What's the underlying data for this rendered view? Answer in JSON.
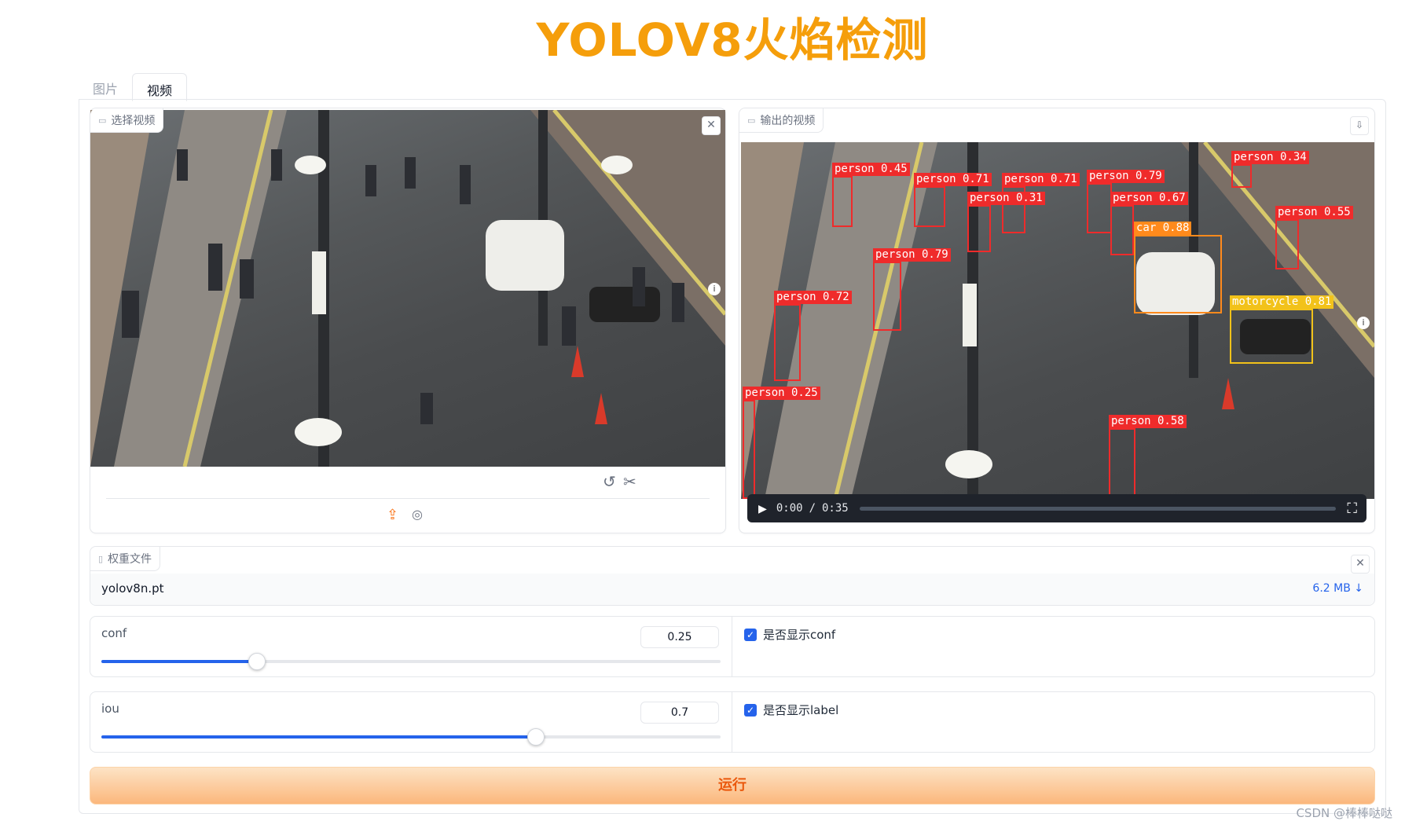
{
  "title": "YOLOV8火焰检测",
  "tabs": [
    {
      "label": "图片",
      "active": false
    },
    {
      "label": "视频",
      "active": true
    }
  ],
  "input_video": {
    "label": "选择视频",
    "icons": [
      "video-camera-icon",
      "close-icon",
      "undo-icon",
      "scissors-icon",
      "upload-icon",
      "webcam-icon"
    ]
  },
  "output_video": {
    "label": "输出的视频",
    "time_current": "0:00",
    "time_separator": "/",
    "time_total": "0:35",
    "progress": 0,
    "detections": [
      {
        "label": "person 0.45",
        "cls": "r"
      },
      {
        "label": "person 0.71",
        "cls": "r"
      },
      {
        "label": "person 0.71",
        "cls": "r"
      },
      {
        "label": "person 0.79",
        "cls": "r"
      },
      {
        "label": "person 0.34",
        "cls": "r"
      },
      {
        "label": "person 0.31",
        "cls": "r"
      },
      {
        "label": "person 0.67",
        "cls": "r"
      },
      {
        "label": "person 0.55",
        "cls": "r"
      },
      {
        "label": "car 0.88",
        "cls": "o"
      },
      {
        "label": "person 0.79",
        "cls": "r"
      },
      {
        "label": "person 0.72",
        "cls": "r"
      },
      {
        "label": "motorcycle 0.81",
        "cls": "y"
      },
      {
        "label": "person 0.25",
        "cls": "r"
      },
      {
        "label": "person 0.58",
        "cls": "r"
      }
    ]
  },
  "weights": {
    "label": "权重文件",
    "filename": "yolov8n.pt",
    "size": "6.2 MB ↓"
  },
  "conf": {
    "label": "conf",
    "value": "0.25",
    "fraction": 0.25,
    "checkbox_label": "是否显示conf",
    "checked": true
  },
  "iou": {
    "label": "iou",
    "value": "0.7",
    "fraction": 0.7,
    "checkbox_label": "是否显示label",
    "checked": true
  },
  "run_button": "运行",
  "watermark": "CSDN @棒棒哒哒"
}
